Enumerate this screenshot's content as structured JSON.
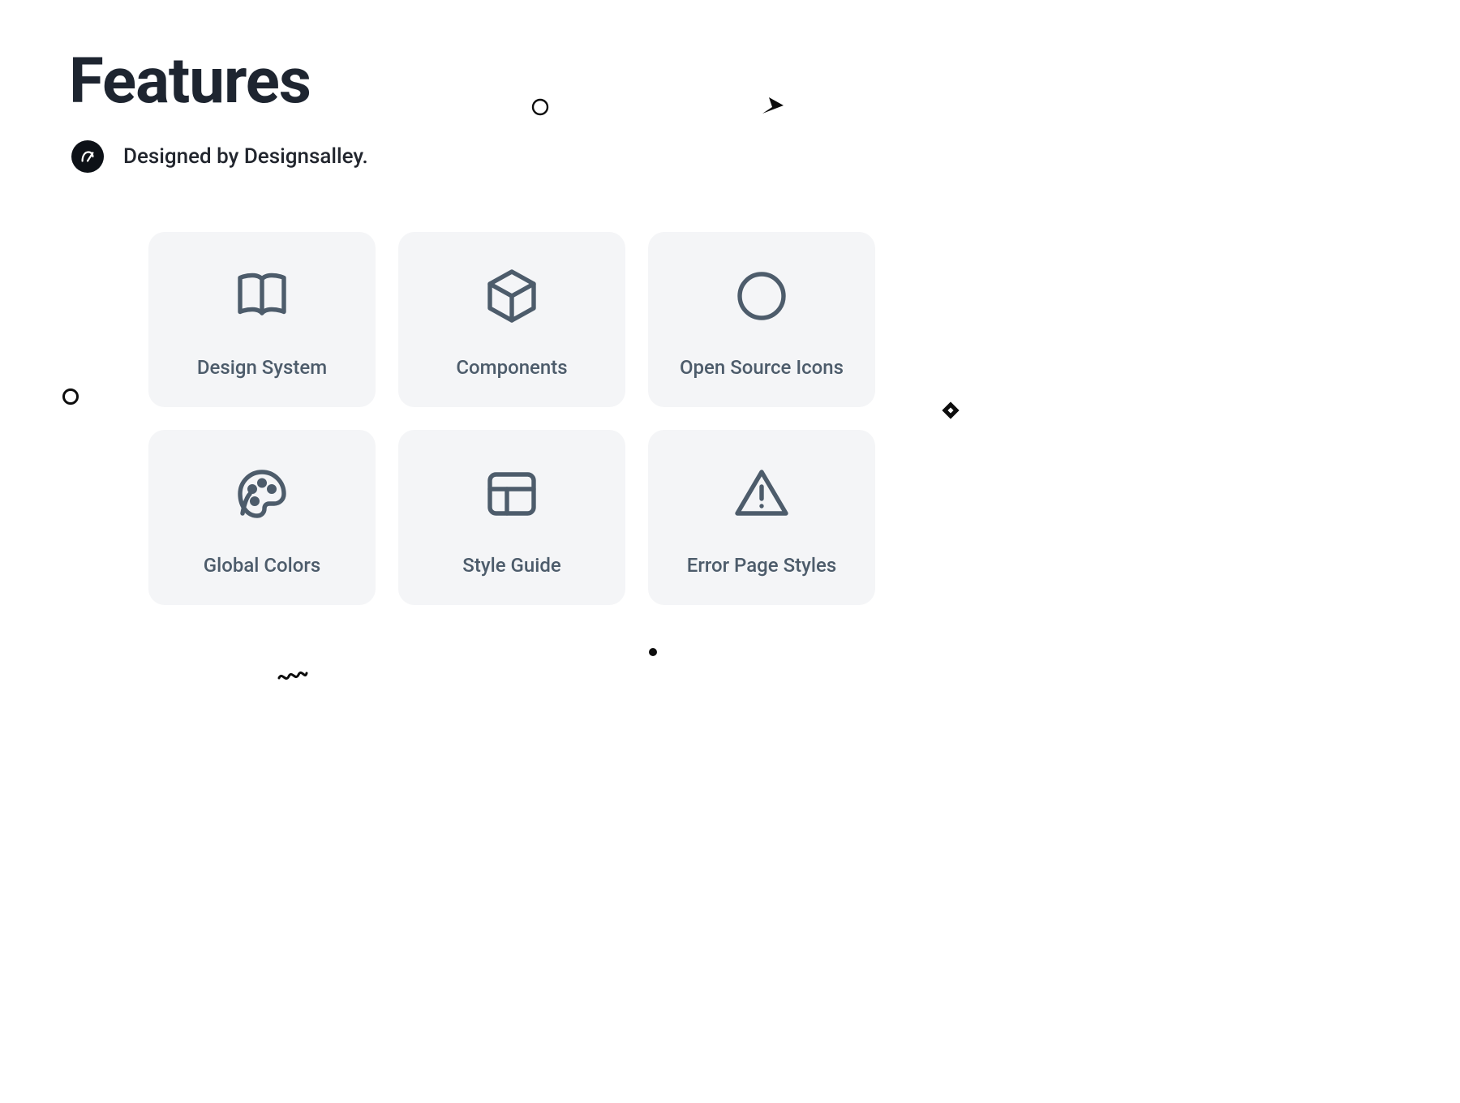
{
  "header": {
    "title": "Features",
    "subtitle": "Designed by Designsalley."
  },
  "cards": [
    {
      "label": "Design System",
      "icon": "book-icon"
    },
    {
      "label": "Components",
      "icon": "cube-icon"
    },
    {
      "label": "Open Source Icons",
      "icon": "circle-icon"
    },
    {
      "label": "Global Colors",
      "icon": "palette-icon"
    },
    {
      "label": "Style Guide",
      "icon": "layout-icon"
    },
    {
      "label": "Error Page Styles",
      "icon": "warning-icon"
    }
  ],
  "colors": {
    "heading": "#1e2530",
    "card_bg": "#f4f5f7",
    "card_fg": "#4d5c6b",
    "page_bg": "#ffffff"
  }
}
